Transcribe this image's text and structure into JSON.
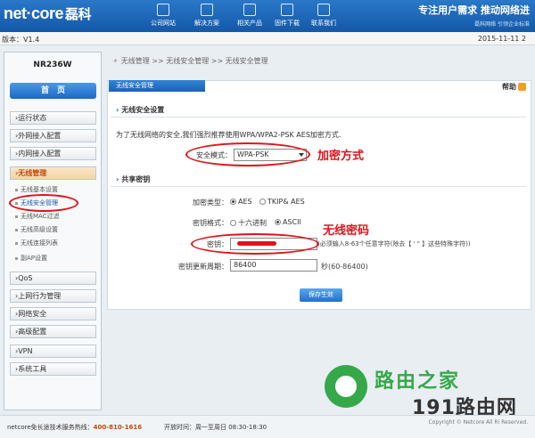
{
  "brand": {
    "logo": "net·core",
    "logo_cn": "磊科",
    "slogan": "专注用户需求  推动网络进",
    "subslogan": "磊科网络  引领企业标准"
  },
  "nav": [
    {
      "label": "公司网站",
      "icon": "home-icon"
    },
    {
      "label": "解决方案",
      "icon": "tools-icon"
    },
    {
      "label": "相关产品",
      "icon": "product-icon"
    },
    {
      "label": "固件下载",
      "icon": "download-icon"
    },
    {
      "label": "联系我们",
      "icon": "contact-icon"
    }
  ],
  "version": "版本：V1.4",
  "date": "2015-11-11 2",
  "sidebar": {
    "model": "NR236W",
    "home": "首　页",
    "menus": [
      "›运行状态",
      "›外网接入配置",
      "›内网接入配置",
      "›无线管理",
      "›QoS",
      "›上网行为管理",
      "›网络安全",
      "›高级配置",
      "›VPN",
      "›系统工具"
    ],
    "submenus": [
      "无线基本设置",
      "无线安全管理",
      "无线MAC过滤",
      "无线高级设置",
      "无线连接列表",
      "副AP设置"
    ]
  },
  "breadcrumb": "无线管理  >>  无线安全管理  >>  无线安全管理",
  "panel": {
    "tab": "无线安全管理",
    "help": "帮助",
    "section1": "无线安全设置",
    "desc": "为了无线网络的安全,我们强烈推荐使用WPA/WPA2-PSK AES加密方式.",
    "security_mode_label": "安全模式：",
    "security_mode_value": "WPA-PSK",
    "section2": "共享密钥",
    "enc_type_label": "加密类型：",
    "enc_aes": "AES",
    "enc_tkip": "TKIP& AES",
    "key_format_label": "密钥格式：",
    "fmt_hex": "十六进制",
    "fmt_ascii": "ASCII",
    "key_label": "密钥：",
    "key_hint": "(必须输入8-63个任意字符(除去【 ' \" 】这些特殊字符))",
    "renew_label": "密钥更新周期：",
    "renew_value": "86400",
    "renew_hint": "秒(60-86400)",
    "save": "保存生效"
  },
  "annotations": {
    "encryption": "加密方式",
    "password": "无线密码"
  },
  "footer": {
    "hotline": "netcore免长途技术服务热线：",
    "phone": "400-810-1616",
    "hours": "开放时间：周一至周日 08:30-18:30",
    "copyright": "Copyright © Netcore All Ri\nReserved."
  },
  "watermark": {
    "line1": "路由之家",
    "line2": "191路由网"
  }
}
